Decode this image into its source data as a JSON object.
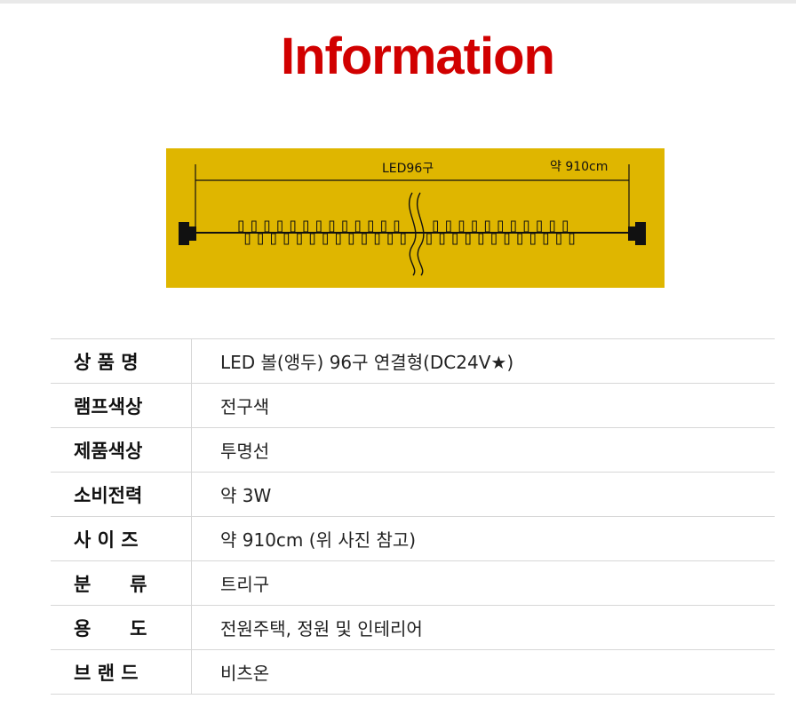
{
  "title": "Information",
  "diagram": {
    "bulb_label": "LED96구",
    "length_label": "약 910cm"
  },
  "specs": [
    {
      "label": "상 품 명",
      "value": "LED 볼(앵두) 96구 연결형(DC24V★)"
    },
    {
      "label": "램프색상",
      "value": "전구색"
    },
    {
      "label": "제품색상",
      "value": "투명선"
    },
    {
      "label": "소비전력",
      "value": "약 3W"
    },
    {
      "label": "사 이 즈",
      "value": "약 910cm (위 사진 참고)"
    },
    {
      "label": "분      류",
      "value": "트리구"
    },
    {
      "label": "용      도",
      "value": "전원주택, 정원 및 인테리어"
    },
    {
      "label": "브 랜 드",
      "value": "비츠온"
    }
  ],
  "colors": {
    "title": "#d10000",
    "diagram_bg": "#dfb600"
  }
}
